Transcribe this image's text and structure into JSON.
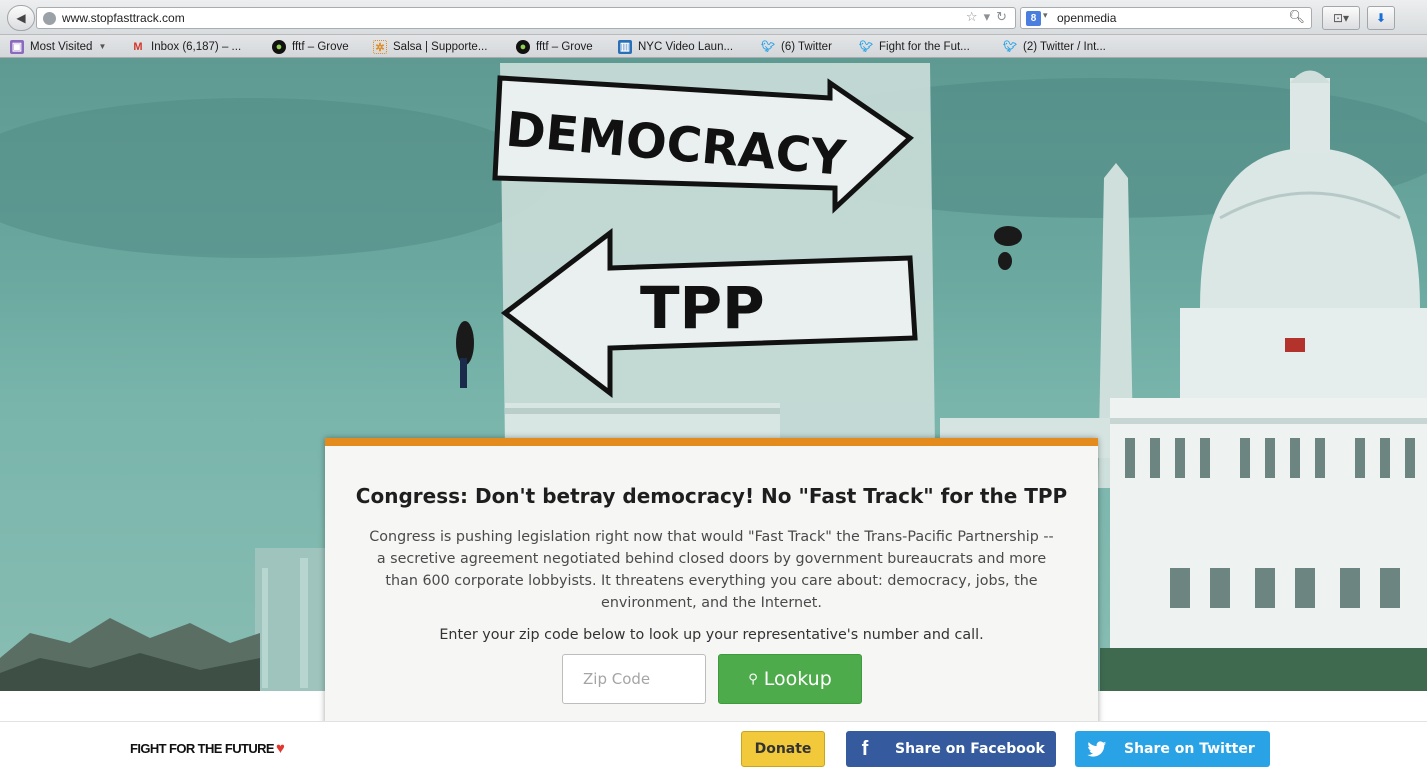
{
  "browser": {
    "url": "www.stopfasttrack.com",
    "search_query": "openmedia",
    "search_engine_letter": "8",
    "bookmarks": [
      {
        "label": "Most Visited",
        "icon": "folder-icon"
      },
      {
        "label": "Inbox (6,187) – ...",
        "icon": "gmail-icon"
      },
      {
        "label": "fftf – Grove",
        "icon": "grove-icon"
      },
      {
        "label": "Salsa | Supporte...",
        "icon": "salsa-icon"
      },
      {
        "label": "fftf – Grove",
        "icon": "grove-icon"
      },
      {
        "label": "NYC Video Laun...",
        "icon": "trello-icon"
      },
      {
        "label": "(6) Twitter",
        "icon": "twitter-icon"
      },
      {
        "label": "Fight for the Fut...",
        "icon": "twitter-icon"
      },
      {
        "label": "(2) Twitter / Int...",
        "icon": "twitter-icon"
      }
    ]
  },
  "hero": {
    "banner_top_text": "DEMOCRACY",
    "banner_bottom_text": "TPP"
  },
  "card": {
    "title": "Congress: Don't betray democracy! No \"Fast Track\" for the TPP",
    "description": "Congress is pushing legislation right now that would \"Fast Track\" the Trans-Pacific Partnership -- a secretive agreement negotiated behind closed doors by government bureaucrats and more than 600 corporate lobbyists. It threatens everything you care about: democracy, jobs, the environment, and the Internet.",
    "prompt": "Enter your zip code below to look up your representative's number and call.",
    "zip_placeholder": "Zip Code",
    "lookup_label": "Lookup",
    "accent_color": "#e38b1d"
  },
  "footer": {
    "brand_text": "FIGHT FOR THE FUTURE",
    "donate_label": "Donate",
    "facebook_label": "Share on Facebook",
    "twitter_label": "Share on Twitter",
    "colors": {
      "donate": "#f1c93b",
      "facebook": "#355b9e",
      "twitter": "#2aa3e6",
      "lookup": "#4eab4b"
    }
  }
}
